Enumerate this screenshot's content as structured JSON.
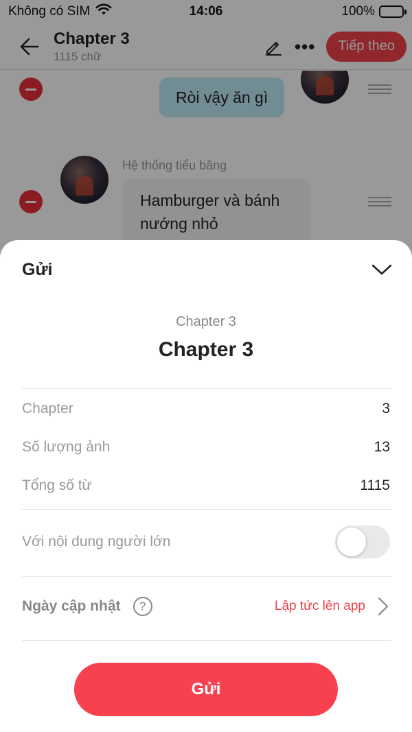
{
  "status_bar": {
    "carrier": "Không có SIM",
    "time": "14:06",
    "battery": "100%",
    "battery_level": 1.0
  },
  "header": {
    "title": "Chapter 3",
    "word_count": "1115 chữ",
    "next_label": "Tiếp theo",
    "icons": [
      "back-arrow-icon",
      "pen-icon",
      "more-icon"
    ]
  },
  "chat": {
    "msg1": "Ròi vậy ăn gì",
    "sender2": "Hệ thống tiểu băng",
    "msg2": "Hamburger và bánh nướng nhỏ"
  },
  "sheet": {
    "title": "Gửi",
    "subtitle": "Chapter 3",
    "chapter_title": "Chapter 3",
    "rows": [
      {
        "label": "Chapter",
        "value": "3"
      },
      {
        "label": "Số lượng ảnh",
        "value": "13"
      },
      {
        "label": "Tổng số từ",
        "value": "1115"
      }
    ],
    "adult_label": "Với nội dung người lớn",
    "adult_enabled": false,
    "date_label": "Ngày cập nhật",
    "help_glyph": "?",
    "date_value": "Lập tức lên app",
    "submit_label": "Gửi"
  },
  "colors": {
    "accent": "#f0414b",
    "bubble_right": "#bfe9f5",
    "bubble_left": "#f3f3f3",
    "toggle_off": "#e9e9e9"
  }
}
